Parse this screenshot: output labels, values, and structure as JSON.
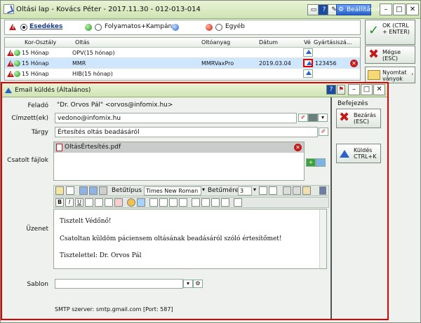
{
  "window": {
    "title": "Oltási lap - Kovács Péter - 2017.11.30 - 012-013-014",
    "settings_label": "Beállítások",
    "min_label": "–",
    "max_label": "□",
    "close_label": "✕"
  },
  "filters": {
    "esedekes": "Esedékes",
    "folyamatos": "Folyamatos+Kampány",
    "egyeb": "Egyéb"
  },
  "grid": {
    "headers": {
      "kor": "Kor-Osztály",
      "oltas": "Oltás",
      "anyag": "Oltóanyag",
      "datum": "Dátum",
      "ve": "Vé",
      "gyartas": "Gyártásiszá..."
    },
    "rows": [
      {
        "kor": "15 Hónap",
        "oltas": "OPV(15 hónap)",
        "anyag": "",
        "datum": "",
        "gyartas": ""
      },
      {
        "kor": "15 Hónap",
        "oltas": "MMR",
        "anyag": "MMRVaxPro",
        "datum": "2019.03.04",
        "gyartas": "123456"
      },
      {
        "kor": "15 Hónap",
        "oltas": "HIB(15 hónap)",
        "anyag": "",
        "datum": "",
        "gyartas": ""
      }
    ]
  },
  "right_buttons": {
    "ok": "OK (CTRL + ENTER)",
    "cancel": "Mégse (ESC)",
    "print": "Nyomtat ványok"
  },
  "email": {
    "title": "Email küldés (Általános)",
    "labels": {
      "sender": "Feladó",
      "recipient": "Címzett(ek)",
      "subject": "Tárgy",
      "attachments": "Csatolt fájlok",
      "message": "Üzenet",
      "template": "Sablon"
    },
    "sender": "\"Dr. Orvos Pál\" <orvos@infomix.hu>",
    "recipient": "vedono@infomix.hu",
    "subject": "Értesítés oltás beadásáról",
    "attachment": "OltásÉrtesítés.pdf",
    "toolbar": {
      "font_label": "Betűtípus",
      "font_value": "Times New Roman",
      "size_label": "Betűméret",
      "size_value": "3"
    },
    "message_lines": [
      "Tisztelt Védőnő!",
      "Csatoltan küldöm páciensem oltásának beadásáról szóló értesítőmet!",
      "Tisztelettel: Dr. Orvos Pál"
    ],
    "template_value": "",
    "smtp": "SMTP szerver: smtp.gmail.com [Port: 587]",
    "right": {
      "heading": "Befejezés",
      "close": "Bezárás (ESC)",
      "send": "Küldés CTRL+K"
    }
  }
}
